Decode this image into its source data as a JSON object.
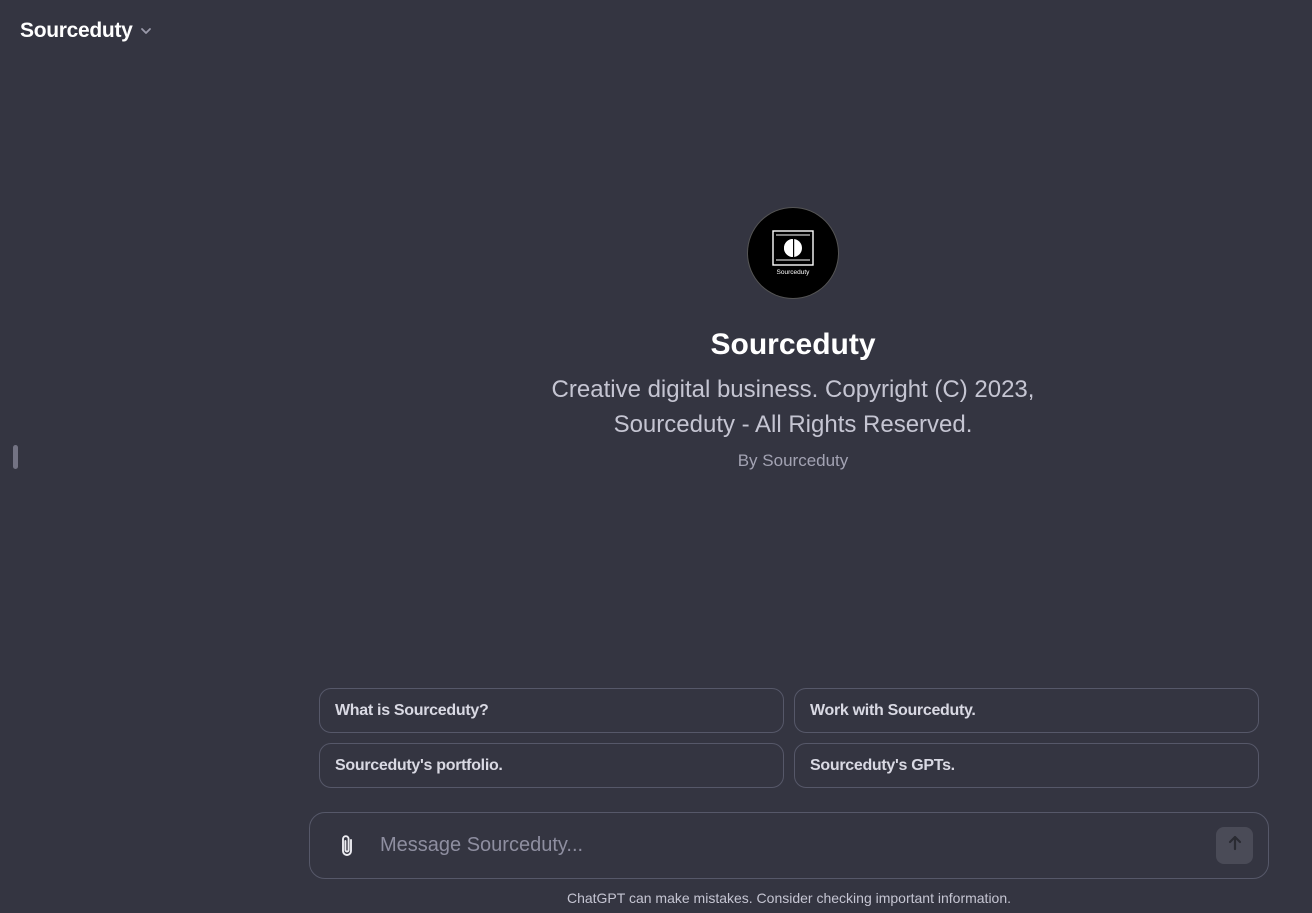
{
  "header": {
    "title": "Sourceduty"
  },
  "gpt": {
    "avatar_text": "Sourceduty",
    "name": "Sourceduty",
    "description": "Creative digital business. Copyright (C) 2023, Sourceduty - All Rights Reserved.",
    "author": "By Sourceduty"
  },
  "suggestions": [
    {
      "label": "What is Sourceduty?"
    },
    {
      "label": "Work with Sourceduty."
    },
    {
      "label": "Sourceduty's portfolio."
    },
    {
      "label": "Sourceduty's GPTs."
    }
  ],
  "composer": {
    "placeholder": "Message Sourceduty...",
    "value": ""
  },
  "footer": {
    "note": "ChatGPT can make mistakes. Consider checking important information."
  },
  "icons": {
    "header_menu": "chevron-down-icon",
    "attach": "paperclip-icon",
    "send": "arrow-up-icon"
  },
  "colors": {
    "background": "#343541",
    "border": "#565869",
    "text_primary": "#ffffff",
    "text_secondary": "#c5c5d2",
    "send_button_bg": "#4a4b57"
  }
}
